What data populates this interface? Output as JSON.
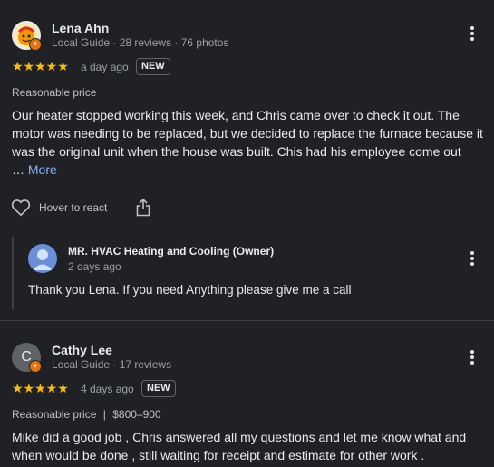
{
  "reviews": [
    {
      "reviewer": "Lena Ahn",
      "meta": "Local Guide · 28 reviews · 76 photos",
      "stars": "★★★★★",
      "time": "a day ago",
      "new_tag": "NEW",
      "tags": "Reasonable price",
      "text": "Our heater stopped working this week, and Chris came over to check it out. The motor was needing to be replaced, but we decided to replace the furnace because it was the original unit when the house was built. Chis had his employee come out",
      "ellipsis": "…",
      "more": "More",
      "react": "Hover to react",
      "reply": {
        "author": "MR. HVAC Heating and Cooling (Owner)",
        "time": "2 days ago",
        "text": "Thank you Lena. If you need Anything please give me a call"
      }
    },
    {
      "reviewer": "Cathy Lee",
      "avatar_letter": "C",
      "meta": "Local Guide · 17 reviews",
      "stars": "★★★★★",
      "time": "4 days ago",
      "new_tag": "NEW",
      "tag1": "Reasonable price",
      "separator": "|",
      "tag2": "$800–900",
      "text": "Mike did a good job , Chris answered all my questions and let me know what and when would be done , still waiting for receipt and estimate for other work ."
    }
  ],
  "colors": {
    "background": "#202124",
    "star": "#fbbc04",
    "link": "#8ab4f8",
    "badge": "#e8710a"
  }
}
